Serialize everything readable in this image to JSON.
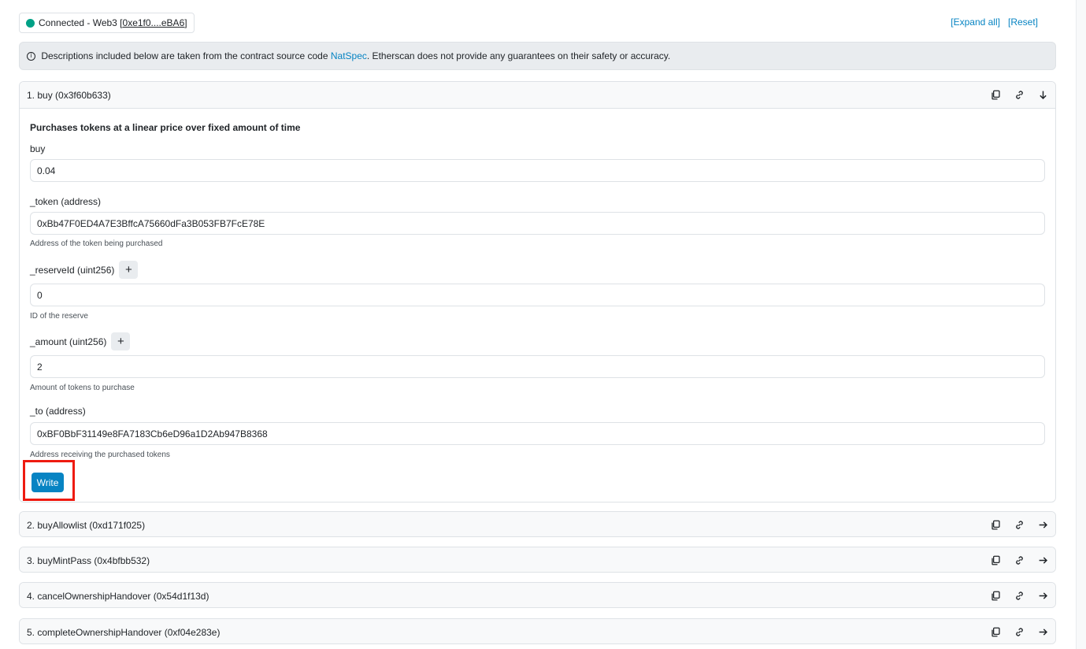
{
  "header": {
    "connected_prefix": "Connected - Web3 [",
    "connected_address": "0xe1f0....eBA6",
    "connected_suffix": "]",
    "expand_all": "[Expand all]",
    "reset": "[Reset]"
  },
  "banner": {
    "info_glyph": "i",
    "text_before": " Descriptions included below are taken from the contract source code ",
    "link": "NatSpec",
    "text_after": ". Etherscan does not provide any guarantees on their safety or accuracy."
  },
  "functions": [
    {
      "title": "1. buy (0x3f60b633)",
      "expanded": true,
      "description": "Purchases tokens at a linear price over fixed amount of time",
      "payable_label": "buy",
      "payable_value": "0.04",
      "params": [
        {
          "label": "_token (address)",
          "value": "0xBb47F0ED4A7E3BffcA75660dFa3B053FB7FcE78E",
          "hint": "Address of the token being purchased"
        },
        {
          "label": "_reserveId (uint256)",
          "value": "0",
          "hint": "ID of the reserve"
        },
        {
          "label": "_amount (uint256)",
          "value": "2",
          "hint": "Amount of tokens to purchase"
        },
        {
          "label": "_to (address)",
          "value": "0xBF0BbF31149e8FA7183Cb6eD96a1D2Ab947B8368",
          "hint": "Address receiving the purchased tokens"
        }
      ],
      "plus_glyph": "+",
      "write_label": "Write"
    },
    {
      "title": "2. buyAllowlist (0xd171f025)",
      "expanded": false
    },
    {
      "title": "3. buyMintPass (0x4bfbb532)",
      "expanded": false
    },
    {
      "title": "4. cancelOwnershipHandover (0x54d1f13d)",
      "expanded": false
    },
    {
      "title": "5. completeOwnershipHandover (0xf04e283e)",
      "expanded": false
    }
  ],
  "icons": {
    "copy": "copy-icon",
    "link": "link-icon",
    "expanded": "arrow-down-icon",
    "collapsed": "arrow-right-icon"
  },
  "colors": {
    "accent": "#0784c3",
    "connected": "#00a186",
    "highlight": "#ee1b10"
  }
}
